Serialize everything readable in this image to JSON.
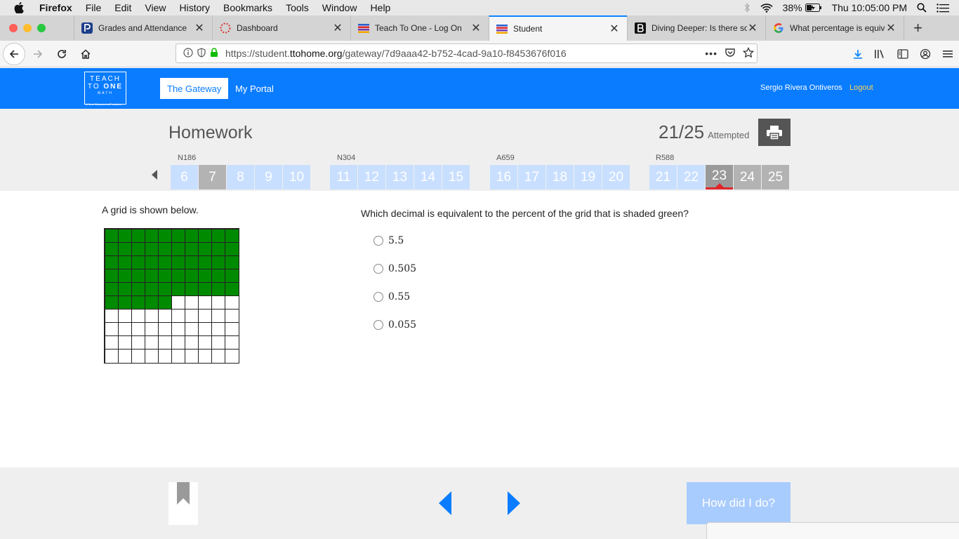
{
  "menubar": {
    "app_name": "Firefox",
    "items": [
      "File",
      "Edit",
      "View",
      "History",
      "Bookmarks",
      "Tools",
      "Window",
      "Help"
    ],
    "battery": "38%",
    "clock": "Thu 10:05:00 PM"
  },
  "tabs": [
    {
      "title": "Grades and Attendance",
      "icon": "p-logo-icon",
      "active": false
    },
    {
      "title": "Dashboard",
      "icon": "dashboard-spinner-icon",
      "active": false
    },
    {
      "title": "Teach To One - Log On",
      "icon": "ttone-icon",
      "active": false
    },
    {
      "title": "Student",
      "icon": "ttone-icon",
      "active": true
    },
    {
      "title": "Diving Deeper: Is there so",
      "icon": "b-logo-icon",
      "active": false
    },
    {
      "title": "What percentage is equiva",
      "icon": "google-icon",
      "active": false
    }
  ],
  "address": {
    "url_prefix": "https://student.",
    "url_domain": "ttohome.org",
    "url_suffix": "/gateway/7d9aaa42-b752-4cad-9a10-f8453676f016"
  },
  "site": {
    "logo_line1": "TEACH",
    "logo_line2a": "TO ",
    "logo_line2b": "ONE",
    "logo_line3": "MATH",
    "logo_tagline": "A New Classrooms® solution",
    "nav_gateway": "The Gateway",
    "nav_portal": "My Portal",
    "user_name": "Sergio Rivera Ontiveros",
    "logout": "Logout"
  },
  "homework": {
    "title": "Homework",
    "attempt_count": "21/25",
    "attempt_label": "Attempted",
    "groups": [
      {
        "label": "N186",
        "questions": [
          "6",
          "7",
          "8",
          "9",
          "10"
        ]
      },
      {
        "label": "N304",
        "questions": [
          "11",
          "12",
          "13",
          "14",
          "15"
        ]
      },
      {
        "label": "A659",
        "questions": [
          "16",
          "17",
          "18",
          "19",
          "20"
        ]
      },
      {
        "label": "R588",
        "questions": [
          "21",
          "22",
          "23",
          "24",
          "25"
        ]
      }
    ],
    "visited": [
      "7",
      "24",
      "25"
    ],
    "current": "23"
  },
  "question": {
    "intro": "A grid is shown below.",
    "text": "Which decimal is equivalent to the percent of the grid that is shaded green?",
    "grid_rows": 10,
    "grid_cols": 10,
    "shaded_cells": 55,
    "shade_color": "#008a00",
    "choices": [
      "5.5",
      "0.505",
      "0.55",
      "0.055"
    ]
  },
  "footer": {
    "how_did_label": "How did I do?"
  },
  "colors": {
    "brand_blue": "#0a7cff",
    "question_tile": "#c9dfff",
    "current_marker": "#e0262b"
  }
}
